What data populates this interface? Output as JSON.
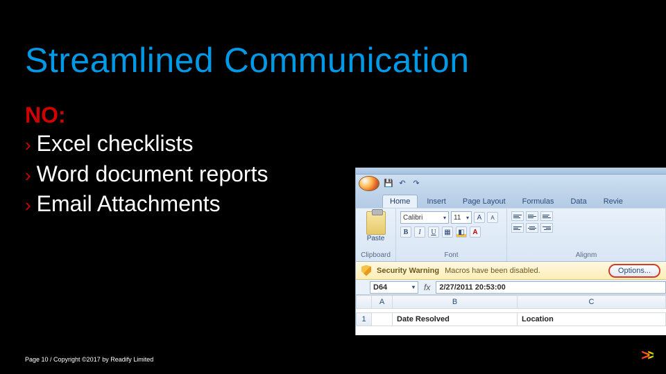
{
  "slide": {
    "title": "Streamlined Communication",
    "no_label": "NO:",
    "bullets": [
      "Excel checklists",
      "Word document reports",
      "Email Attachments"
    ],
    "footer": "Page 10 / Copyright ©2017 by Readify Limited"
  },
  "excel": {
    "tabs": [
      "Home",
      "Insert",
      "Page Layout",
      "Formulas",
      "Data",
      "Revie"
    ],
    "active_tab_index": 0,
    "clipboard": {
      "paste": "Paste",
      "label": "Clipboard"
    },
    "font": {
      "name": "Calibri",
      "size": "11",
      "label": "Font",
      "bold": "B",
      "italic": "I",
      "underline": "U",
      "color_a": "A"
    },
    "alignment": {
      "label": "Alignm"
    },
    "security": {
      "title": "Security Warning",
      "message": "Macros have been disabled.",
      "options": "Options..."
    },
    "namebox": "D64",
    "fx": "fx",
    "formula": "2/27/2011 20:53:00",
    "columns": [
      "",
      "A",
      "B",
      "C"
    ],
    "header_row": {
      "num": "1",
      "a": "",
      "b": "Date Resolved",
      "c": "Location"
    }
  }
}
